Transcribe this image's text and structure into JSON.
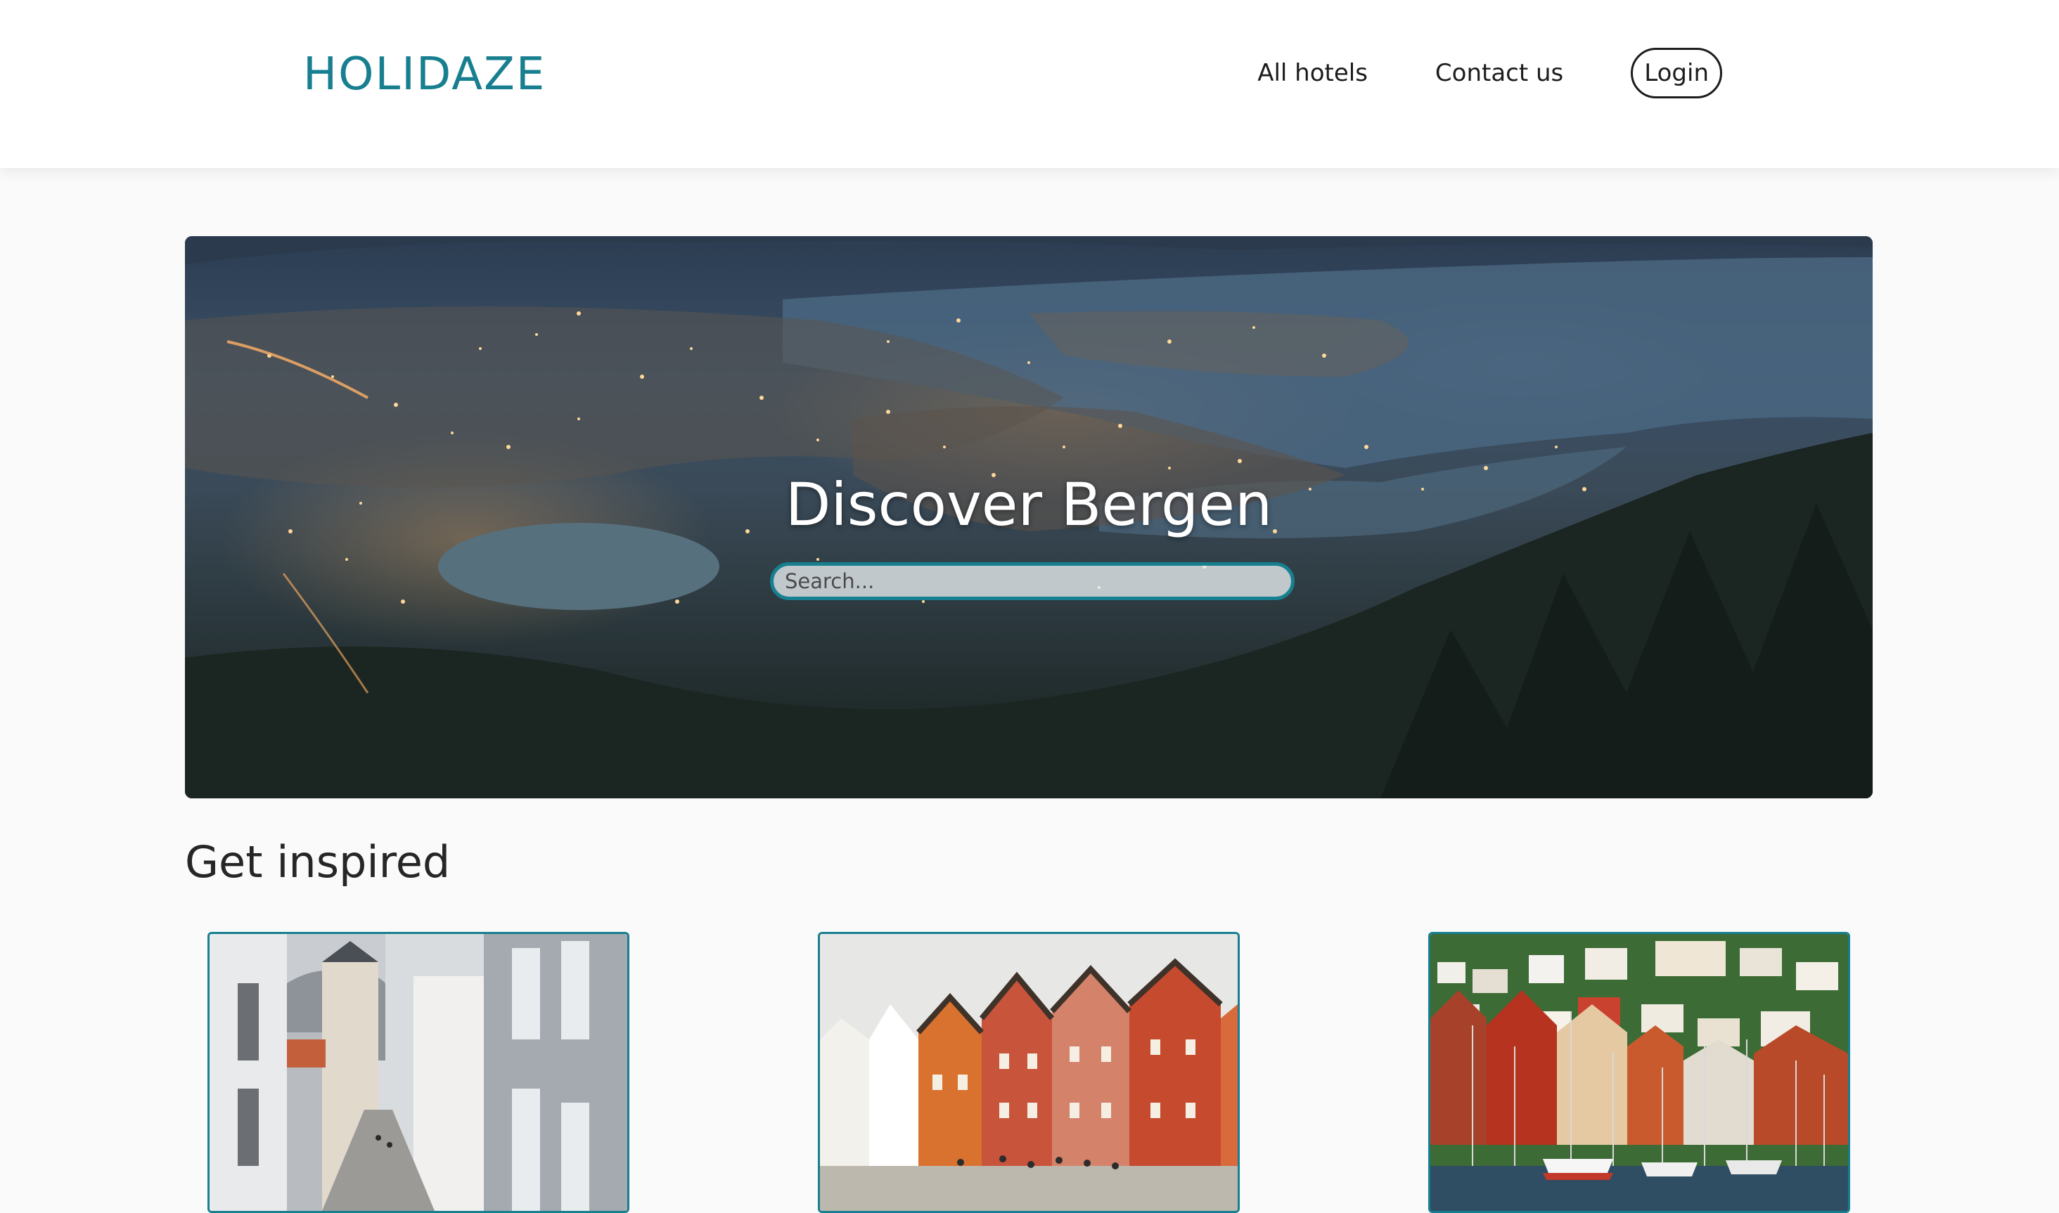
{
  "header": {
    "logo": "HOLIDAZE",
    "nav": {
      "all_hotels": "All hotels",
      "contact_us": "Contact us",
      "login": "Login"
    }
  },
  "hero": {
    "title": "Discover Bergen",
    "search_placeholder": "Search..."
  },
  "inspiration": {
    "title": "Get inspired",
    "cards": [
      {
        "image": "bergen-narrow-street-photo"
      },
      {
        "image": "bryggen-wharf-houses-photo"
      },
      {
        "image": "bergen-harbor-sailboats-photo"
      }
    ]
  },
  "colors": {
    "brand": "#177f8f",
    "background": "#fafafb"
  }
}
